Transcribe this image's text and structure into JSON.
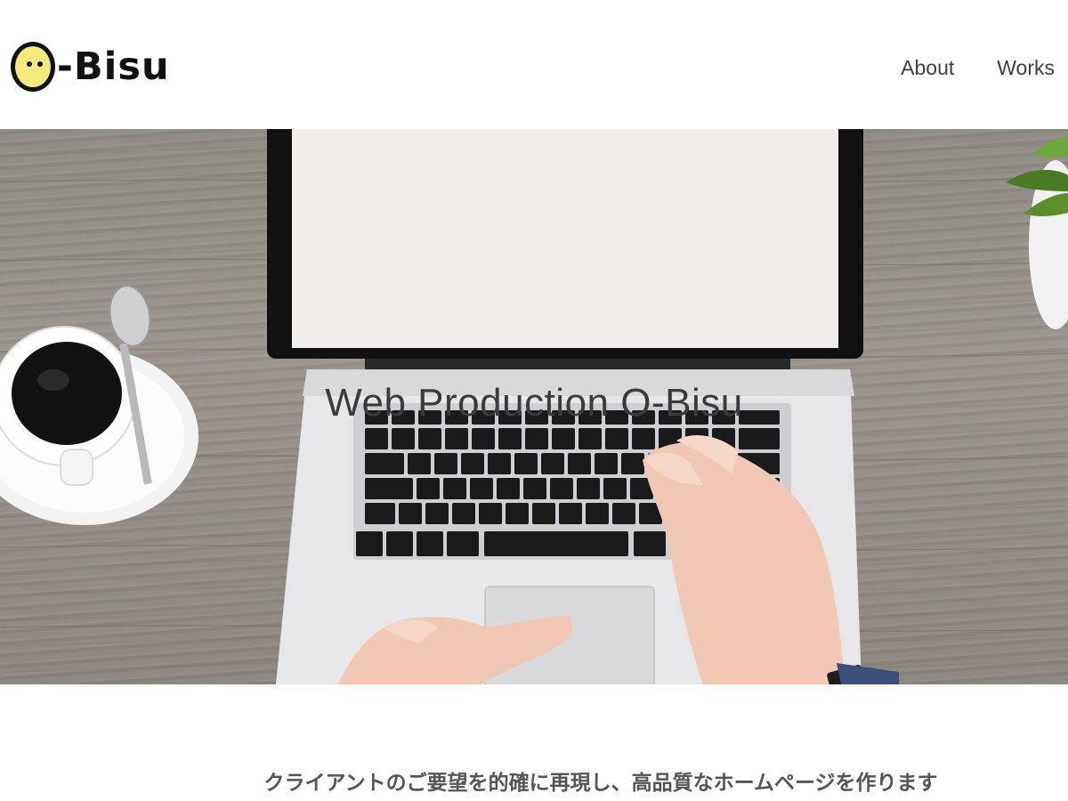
{
  "header": {
    "logo_text": "-Bisu",
    "nav": [
      {
        "label": "About"
      },
      {
        "label": "Works"
      }
    ]
  },
  "hero": {
    "title": "Web Production O-Bisu"
  },
  "main": {
    "tagline": "クライアントのご要望を的確に再現し、高品質なホームページを作ります"
  },
  "colors": {
    "logo_face": "#f6e97e",
    "nav_text": "#3f3f3f",
    "tagline_text": "#555555"
  }
}
